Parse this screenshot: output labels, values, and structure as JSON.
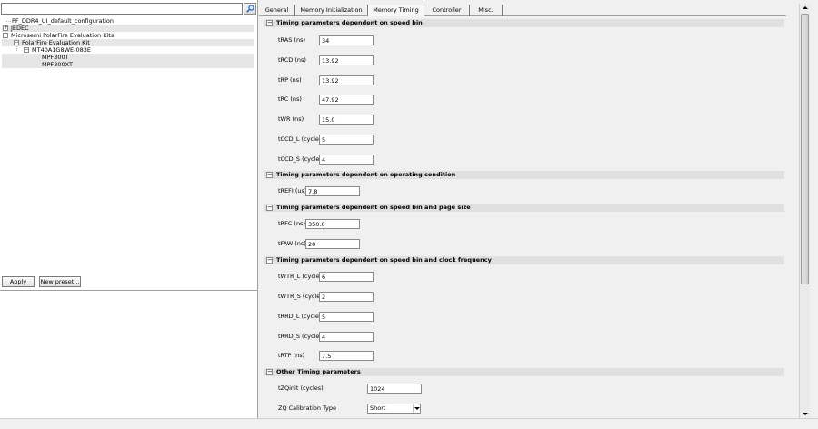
{
  "search": {
    "value": "",
    "icon": "search-icon"
  },
  "tree": {
    "items": [
      {
        "label": "PF_DDR4_UI_default_configuration"
      },
      {
        "label": "JEDEC"
      },
      {
        "label": "Microsemi PolarFire Evaluation Kits"
      },
      {
        "label": "PolarFire Evaluation Kit"
      },
      {
        "label": "MT40A1G8WE-083E"
      },
      {
        "label": "MPF300T"
      },
      {
        "label": "MPF300XT"
      }
    ]
  },
  "buttons": {
    "apply": "Apply",
    "new_preset": "New preset..."
  },
  "tabs": [
    {
      "label": "General"
    },
    {
      "label": "Memory Initialization"
    },
    {
      "label": "Memory Timing"
    },
    {
      "label": "Controller"
    },
    {
      "label": "Misc."
    }
  ],
  "active_tab": "Memory Timing",
  "sections": [
    {
      "title": "Timing parameters dependent on speed bin",
      "fields": [
        {
          "label": "tRAS (ns)",
          "value": "34"
        },
        {
          "label": "tRCD (ns)",
          "value": "13.92"
        },
        {
          "label": "tRP (ns)",
          "value": "13.92"
        },
        {
          "label": "tRC (ns)",
          "value": "47.92"
        },
        {
          "label": "tWR (ns)",
          "value": "15.0"
        },
        {
          "label": "tCCD_L (cycles)",
          "value": "5"
        },
        {
          "label": "tCCD_S (cycles)",
          "value": "4"
        }
      ]
    },
    {
      "title": "Timing parameters dependent on operating condition",
      "fields": [
        {
          "label": "tREFI (us)",
          "value": "7.8"
        }
      ]
    },
    {
      "title": "Timing parameters dependent on speed bin and page size",
      "fields": [
        {
          "label": "tRFC (ns)",
          "value": "350.0"
        },
        {
          "label": "tFAW (ns)",
          "value": "20"
        }
      ]
    },
    {
      "title": "Timing parameters dependent on speed bin and clock frequency",
      "fields": [
        {
          "label": "tWTR_L (cycles)",
          "value": "6"
        },
        {
          "label": "tWTR_S (cycles)",
          "value": "2"
        },
        {
          "label": "tRRD_L (cycles)",
          "value": "5"
        },
        {
          "label": "tRRD_S (cycles)",
          "value": "4"
        },
        {
          "label": "tRTP (ns)",
          "value": "7.5"
        }
      ]
    },
    {
      "title": "Other Timing parameters",
      "fields": [
        {
          "label": "tZQinit (cycles)",
          "value": "1024"
        },
        {
          "label": "ZQ Calibration Type",
          "value": "Short"
        }
      ]
    }
  ],
  "colors": {
    "section_header": "#e0e0e0",
    "panel_bg": "#f0f0f0",
    "tree_highlight": "#e6e6e6"
  }
}
